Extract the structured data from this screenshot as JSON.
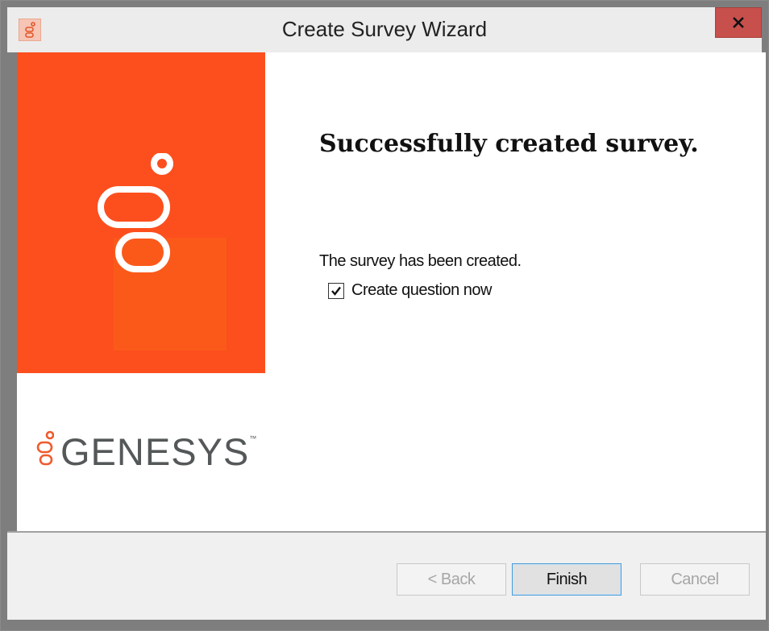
{
  "window": {
    "title": "Create Survey Wizard",
    "close_glyph": "x"
  },
  "brand": {
    "accent_color": "#fc4f1d",
    "logo_icon": "genesys-logo-icon",
    "wordmark": "GENESYS",
    "trademark": "™"
  },
  "main": {
    "heading": "Successfully created survey.",
    "message": "The survey has been created.",
    "checkbox": {
      "label": "Create question now",
      "checked": true
    }
  },
  "footer": {
    "back_label": "< Back",
    "finish_label": "Finish",
    "cancel_label": "Cancel"
  }
}
